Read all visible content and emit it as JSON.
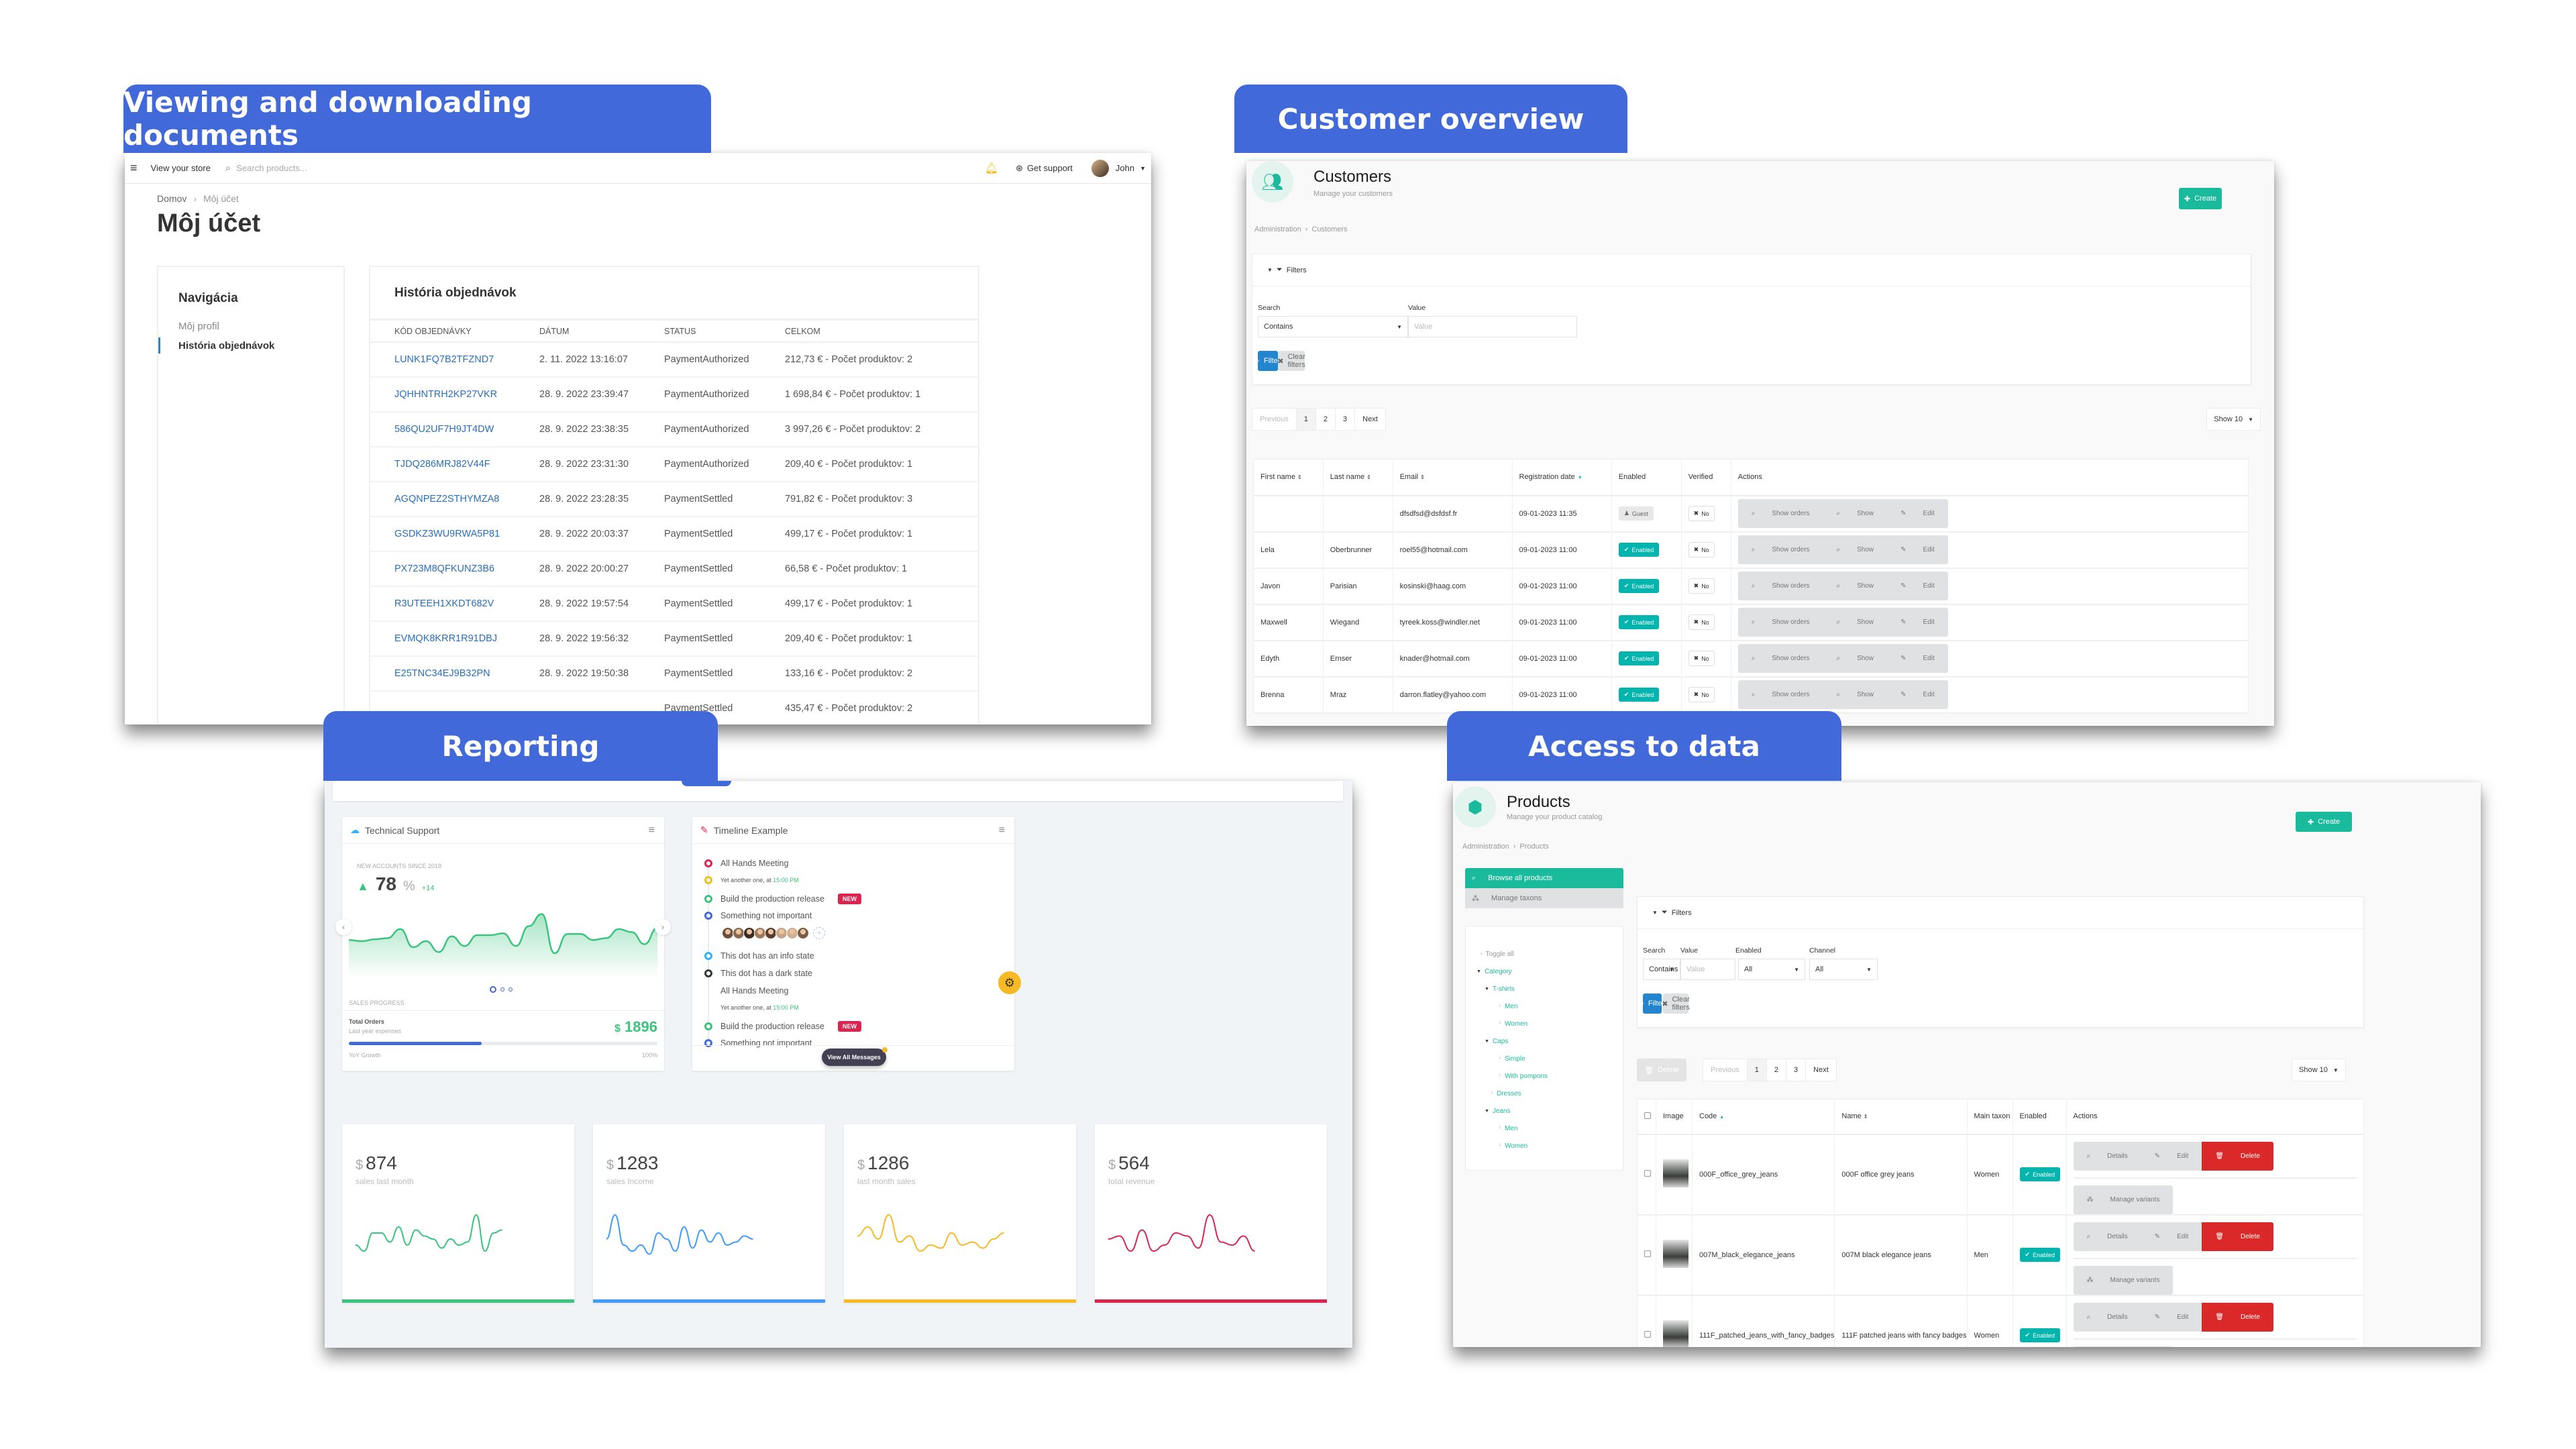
{
  "labels": {
    "documents": "Viewing and downloading documents",
    "customers": "Customer overview",
    "reporting": "Reporting",
    "access": "Access to data"
  },
  "shop": {
    "topbar": {
      "menu_icon": "hamburger-icon",
      "view_store": "View your store",
      "search_placeholder": "Search products...",
      "support": "Get support",
      "user": "John"
    },
    "breadcrumb": [
      "Domov",
      "Môj účet"
    ],
    "title": "Môj účet",
    "nav": {
      "title": "Navigácia",
      "items": [
        {
          "label": "Môj profil",
          "active": false
        },
        {
          "label": "História objednávok",
          "active": true
        }
      ]
    },
    "history": {
      "title": "História objednávok",
      "columns": [
        "KÓD OBJEDNÁVKY",
        "DÁTUM",
        "STATUS",
        "CELKOM"
      ],
      "rows": [
        [
          "LUNK1FQ7B2TFZND7",
          "2. 11. 2022 13:16:07",
          "PaymentAuthorized",
          "212,73 € - Počet produktov: 2"
        ],
        [
          "JQHHNTRH2KP27VKR",
          "28. 9. 2022 23:39:47",
          "PaymentAuthorized",
          "1 698,84 € - Počet produktov: 1"
        ],
        [
          "586QU2UF7H9JT4DW",
          "28. 9. 2022 23:38:35",
          "PaymentAuthorized",
          "3 997,26 € - Počet produktov: 2"
        ],
        [
          "TJDQ286MRJ82V44F",
          "28. 9. 2022 23:31:30",
          "PaymentAuthorized",
          "209,40 € - Počet produktov: 1"
        ],
        [
          "AGQNPEZ2STHYMZA8",
          "28. 9. 2022 23:28:35",
          "PaymentSettled",
          "791,82 € - Počet produktov: 3"
        ],
        [
          "GSDKZ3WU9RWA5P81",
          "28. 9. 2022 20:03:37",
          "PaymentSettled",
          "499,17 € - Počet produktov: 1"
        ],
        [
          "PX723M8QFKUNZ3B6",
          "28. 9. 2022 20:00:27",
          "PaymentSettled",
          "66,58 € - Počet produktov: 1"
        ],
        [
          "R3UTEEH1XKDT682V",
          "28. 9. 2022 19:57:54",
          "PaymentSettled",
          "499,17 € - Počet produktov: 1"
        ],
        [
          "EVMQK8KRR1R91DBJ",
          "28. 9. 2022 19:56:32",
          "PaymentSettled",
          "209,40 € - Počet produktov: 1"
        ],
        [
          "E25TNC34EJ9B32PN",
          "28. 9. 2022 19:50:38",
          "PaymentSettled",
          "133,16 € - Počet produktov: 2"
        ],
        [
          "",
          "",
          "PaymentSettled",
          "435,47 € - Počet produktov: 2"
        ]
      ]
    }
  },
  "customers": {
    "title": "Customers",
    "subtitle": "Manage your customers",
    "breadcrumb": [
      "Administration",
      "Customers"
    ],
    "create": "Create",
    "filters": {
      "title": "Filters",
      "search_label": "Search",
      "search_value": "Contains",
      "value_label": "Value",
      "value_placeholder": "Value",
      "filter_btn": "Filter",
      "clear_btn": "Clear filters"
    },
    "pager": [
      "Previous",
      "1",
      "2",
      "3",
      "Next"
    ],
    "show": "Show 10",
    "columns": [
      "First name",
      "Last name",
      "Email",
      "Registration date",
      "Enabled",
      "Verified",
      "Actions"
    ],
    "rows": [
      {
        "first": "",
        "last": "",
        "email": "dfsdfsd@dsfdsf.fr",
        "date": "09-01-2023 11:35",
        "enabled": "Guest",
        "verified": "No"
      },
      {
        "first": "Lela",
        "last": "Oberbrunner",
        "email": "roel55@hotmail.com",
        "date": "09-01-2023 11:00",
        "enabled": "Enabled",
        "verified": "No"
      },
      {
        "first": "Javon",
        "last": "Parisian",
        "email": "kosinski@haag.com",
        "date": "09-01-2023 11:00",
        "enabled": "Enabled",
        "verified": "No"
      },
      {
        "first": "Maxwell",
        "last": "Wiegand",
        "email": "tyreek.koss@windler.net",
        "date": "09-01-2023 11:00",
        "enabled": "Enabled",
        "verified": "No"
      },
      {
        "first": "Edyth",
        "last": "Ernser",
        "email": "knader@hotmail.com",
        "date": "09-01-2023 11:00",
        "enabled": "Enabled",
        "verified": "No"
      },
      {
        "first": "Brenna",
        "last": "Mraz",
        "email": "darron.flatley@yahoo.com",
        "date": "09-01-2023 11:00",
        "enabled": "Enabled",
        "verified": "No"
      }
    ],
    "actions": [
      "Show orders",
      "Show",
      "Edit"
    ]
  },
  "reporting": {
    "support": {
      "title": "Technical Support",
      "caption": "NEW ACCOUNTS SINCE 2018",
      "value": "78",
      "unit": "%",
      "delta": "+14",
      "section": "SALES PROGRESS",
      "orders_title": "Total Orders",
      "orders_sub": "Last year expenses",
      "orders_value": "1896",
      "currency": "$",
      "growth_label": "YoY Growth",
      "growth_max": "100%",
      "growth_progress": 0.43,
      "series": [
        52,
        50,
        53,
        55,
        70,
        40,
        50,
        32,
        58,
        42,
        60,
        60,
        63,
        42,
        75,
        95,
        30,
        62,
        62,
        52,
        55,
        70,
        65,
        45,
        72
      ]
    },
    "timeline": {
      "title": "Timeline Example",
      "items": [
        {
          "text": "All Hands Meeting",
          "color": "#d92550",
          "dot": true
        },
        {
          "text": "Yet another one, at ",
          "time": "15:00 PM",
          "color": "#f7b924",
          "dot": true,
          "small": true
        },
        {
          "text": "Build the production release",
          "badge": "NEW",
          "color": "#3ac47d",
          "dot": true
        },
        {
          "text": "Something not important",
          "color": "#3f6ad8",
          "dot": true
        },
        {
          "text": "This dot has an info state",
          "color": "#30b1ff",
          "dot": true
        },
        {
          "text": "This dot has a dark state",
          "color": "#343a40",
          "dot": true
        },
        {
          "text": "All Hands Meeting",
          "dot": false
        },
        {
          "text": "Yet another one, at ",
          "time": "15:00 PM",
          "dot": false,
          "small": true
        },
        {
          "text": "Build the production release",
          "badge": "NEW",
          "color": "#3ac47d",
          "dot": true
        },
        {
          "text": "Something not important",
          "color": "#3f6ad8",
          "dot": true
        }
      ],
      "avatar_count": 8,
      "button": "View All Messages"
    },
    "kpis": [
      {
        "value": "874",
        "label": "sales last month",
        "color": "#3ac47d",
        "series": [
          40,
          30,
          60,
          60,
          45,
          70,
          40,
          65,
          55,
          50,
          35,
          50,
          40,
          45,
          90,
          30,
          60,
          65
        ]
      },
      {
        "value": "1283",
        "label": "sales Income",
        "color": "#3f9bff",
        "series": [
          50,
          90,
          40,
          30,
          40,
          25,
          60,
          50,
          30,
          70,
          35,
          65,
          45,
          60,
          40,
          45,
          55,
          50
        ]
      },
      {
        "value": "1286",
        "label": "last month sales",
        "color": "#f7b924",
        "series": [
          55,
          70,
          50,
          90,
          45,
          55,
          30,
          40,
          35,
          60,
          40,
          45,
          35,
          50,
          60
        ]
      },
      {
        "value": "564",
        "label": "total revenue",
        "color": "#d92550",
        "series": [
          50,
          55,
          30,
          65,
          30,
          40,
          60,
          55,
          35,
          90,
          45,
          40,
          55,
          30
        ]
      }
    ],
    "currency": "$"
  },
  "products": {
    "title": "Products",
    "subtitle": "Manage your product catalog",
    "breadcrumb": [
      "Administration",
      "Products"
    ],
    "create": "Create",
    "menu": [
      "Browse all products",
      "Manage taxons"
    ],
    "tree": [
      {
        "label": "Toggle all",
        "level": 0,
        "kind": "toggle"
      },
      {
        "label": "Category",
        "level": 0,
        "kind": "open"
      },
      {
        "label": "T-shirts",
        "level": 1,
        "kind": "open"
      },
      {
        "label": "Men",
        "level": 2,
        "kind": "leaf"
      },
      {
        "label": "Women",
        "level": 2,
        "kind": "leaf"
      },
      {
        "label": "Caps",
        "level": 1,
        "kind": "open"
      },
      {
        "label": "Simple",
        "level": 2,
        "kind": "leaf"
      },
      {
        "label": "With pompons",
        "level": 2,
        "kind": "leaf"
      },
      {
        "label": "Dresses",
        "level": 1,
        "kind": "leaf"
      },
      {
        "label": "Jeans",
        "level": 1,
        "kind": "open"
      },
      {
        "label": "Men",
        "level": 2,
        "kind": "leaf"
      },
      {
        "label": "Women",
        "level": 2,
        "kind": "leaf"
      }
    ],
    "filters": {
      "title": "Filters",
      "search_label": "Search",
      "search_value": "Contains",
      "value_label": "Value",
      "value_placeholder": "Value",
      "enabled_label": "Enabled",
      "enabled_value": "All",
      "channel_label": "Channel",
      "channel_value": "All",
      "filter_btn": "Filter",
      "clear_btn": "Clear filters"
    },
    "delete_btn": "Delete",
    "pager": [
      "Previous",
      "1",
      "2",
      "3",
      "Next"
    ],
    "show": "Show 10",
    "columns": [
      "",
      "Image",
      "Code",
      "Name",
      "Main taxon",
      "Enabled",
      "Actions"
    ],
    "rows": [
      {
        "code": "000F_office_grey_jeans",
        "name": "000F office grey jeans",
        "taxon": "Women",
        "enabled": "Enabled"
      },
      {
        "code": "007M_black_elegance_jeans",
        "name": "007M black elegance jeans",
        "taxon": "Men",
        "enabled": "Enabled"
      },
      {
        "code": "111F_patched_jeans_with_fancy_badges",
        "name": "111F patched jeans with fancy badges",
        "taxon": "Women",
        "enabled": "Enabled"
      }
    ],
    "actions": [
      "Details",
      "Edit",
      "Delete",
      "Manage variants"
    ]
  }
}
